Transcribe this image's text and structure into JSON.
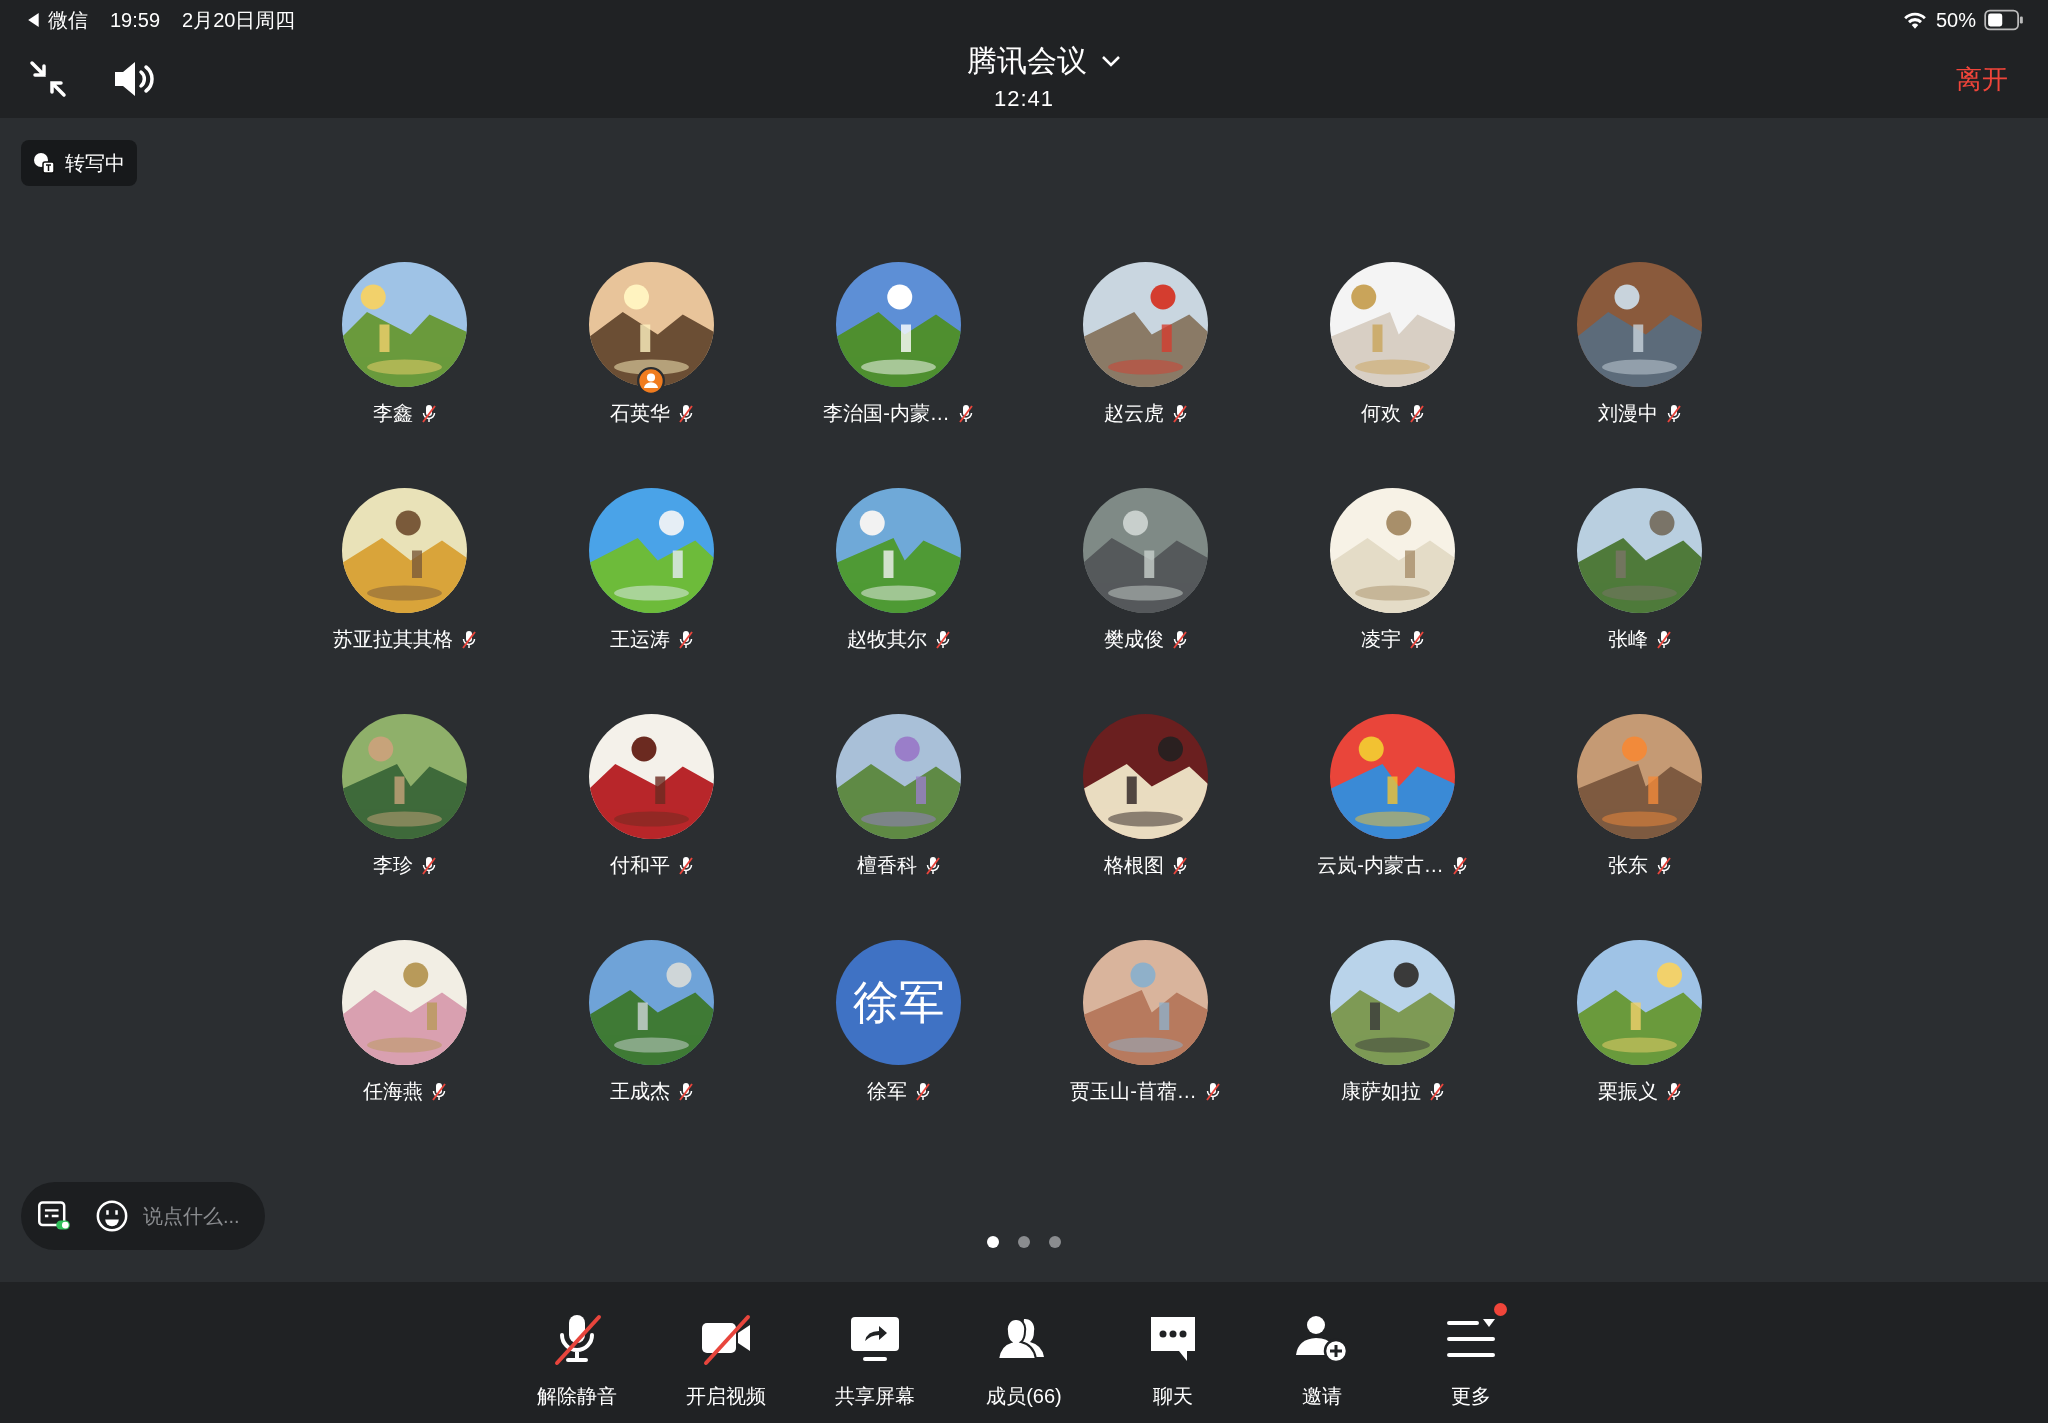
{
  "status_bar": {
    "back_app": "微信",
    "time": "19:59",
    "date": "2月20日周四",
    "battery": "50%"
  },
  "header": {
    "title": "腾讯会议",
    "duration": "12:41",
    "leave": "离开"
  },
  "transcribe_chip": {
    "label": "转写中"
  },
  "participants": [
    {
      "name": "李鑫",
      "muted": true,
      "host": false
    },
    {
      "name": "石英华",
      "muted": true,
      "host": true
    },
    {
      "name": "李治国-内蒙…",
      "muted": true,
      "host": false
    },
    {
      "name": "赵云虎",
      "muted": true,
      "host": false
    },
    {
      "name": "何欢",
      "muted": true,
      "host": false
    },
    {
      "name": "刘漫中",
      "muted": true,
      "host": false
    },
    {
      "name": "苏亚拉其其格",
      "muted": true,
      "host": false
    },
    {
      "name": "王运涛",
      "muted": true,
      "host": false
    },
    {
      "name": "赵牧其尔",
      "muted": true,
      "host": false
    },
    {
      "name": "樊成俊",
      "muted": true,
      "host": false
    },
    {
      "name": "凌宇",
      "muted": true,
      "host": false
    },
    {
      "name": "张峰",
      "muted": true,
      "host": false
    },
    {
      "name": "李珍",
      "muted": true,
      "host": false
    },
    {
      "name": "付和平",
      "muted": true,
      "host": false
    },
    {
      "name": "檀香科",
      "muted": true,
      "host": false
    },
    {
      "name": "格根图",
      "muted": true,
      "host": false
    },
    {
      "name": "云岚-内蒙古…",
      "muted": true,
      "host": false
    },
    {
      "name": "张东",
      "muted": true,
      "host": false
    },
    {
      "name": "任海燕",
      "muted": true,
      "host": false
    },
    {
      "name": "王成杰",
      "muted": true,
      "host": false
    },
    {
      "name": "徐军",
      "muted": true,
      "host": false,
      "avatar": {
        "kind": "initials",
        "text": "徐军"
      }
    },
    {
      "name": "贾玉山-苜蓿…",
      "muted": true,
      "host": false
    },
    {
      "name": "康萨如拉",
      "muted": true,
      "host": false
    },
    {
      "name": "栗振义",
      "muted": true,
      "host": false
    }
  ],
  "chat_input": {
    "placeholder": "说点什么..."
  },
  "pages": [
    {
      "selected": true
    },
    {
      "selected": false
    },
    {
      "selected": false
    }
  ],
  "toolbar": [
    {
      "kind": "mic",
      "label": "解除静音",
      "off": true,
      "badge": false
    },
    {
      "kind": "video",
      "label": "开启视频",
      "off": true,
      "badge": false
    },
    {
      "kind": "share",
      "label": "共享屏幕",
      "off": false,
      "badge": false
    },
    {
      "kind": "members",
      "label": "成员(66)",
      "off": false,
      "badge": false
    },
    {
      "kind": "chat",
      "label": "聊天",
      "off": false,
      "badge": false
    },
    {
      "kind": "invite",
      "label": "邀请",
      "off": false,
      "badge": false
    },
    {
      "kind": "more",
      "label": "更多",
      "off": false,
      "badge": true
    }
  ]
}
